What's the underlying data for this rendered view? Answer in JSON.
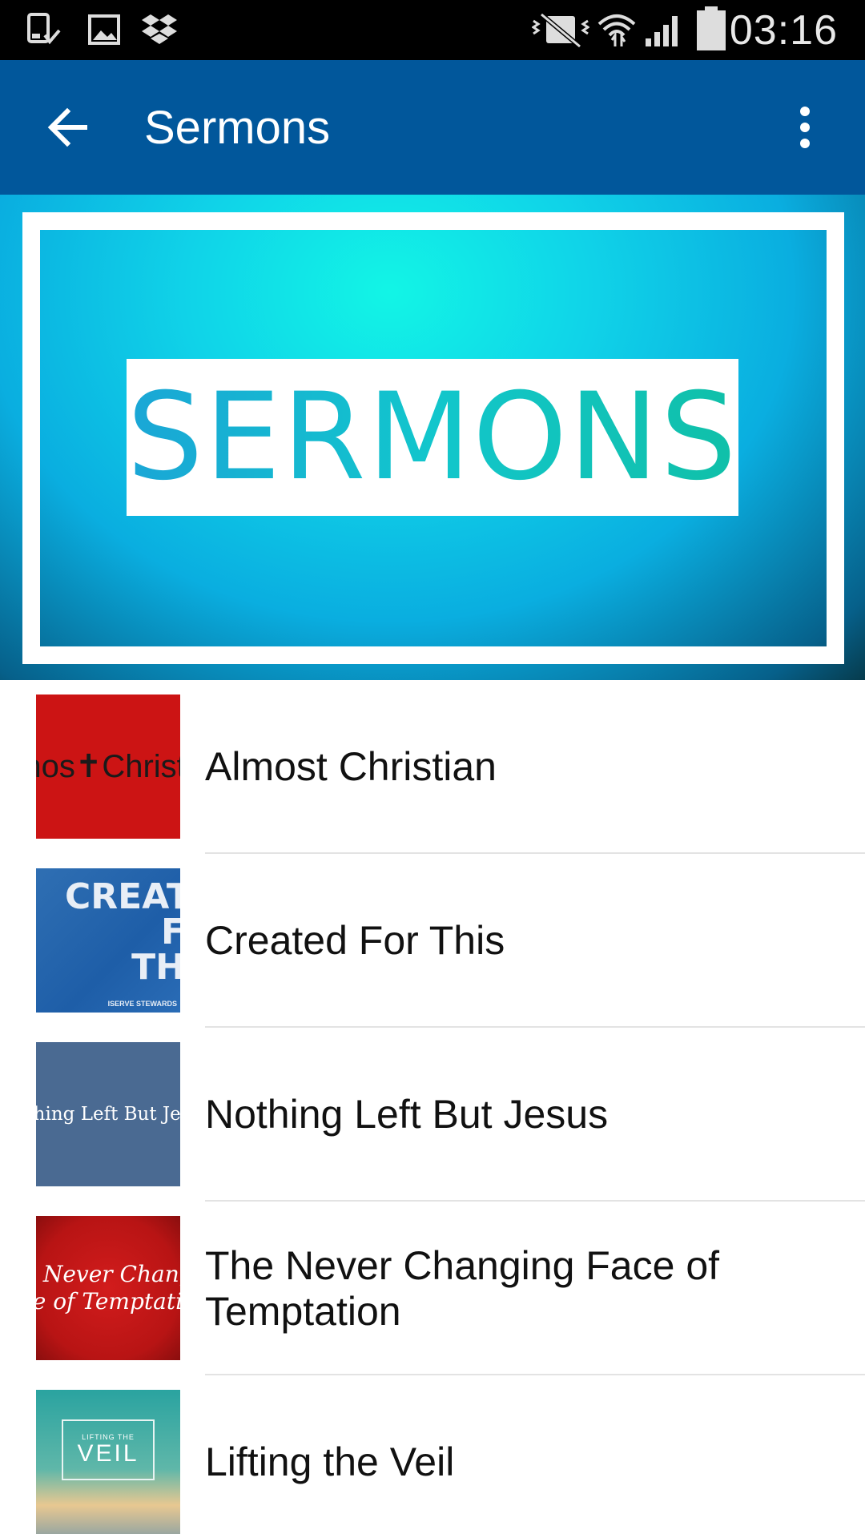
{
  "status_bar": {
    "time": "03:16",
    "icons": [
      "download-complete-icon",
      "image-icon",
      "dropbox-icon",
      "vibrate-icon",
      "wifi-icon",
      "signal-icon",
      "battery-icon"
    ]
  },
  "app_bar": {
    "title": "Sermons",
    "back_icon": "arrow-left-icon",
    "menu_icon": "overflow-menu-icon",
    "color": "#01579b"
  },
  "banner": {
    "text": "SERMONS"
  },
  "sermons": [
    {
      "title": "Almost Christian",
      "thumb_text": "nos✝Christi"
    },
    {
      "title": "Created For This",
      "thumb_text": "CREAT F TH",
      "thumb_subtext": "ISERVE STEWARDS"
    },
    {
      "title": "Nothing Left But Jesus",
      "thumb_text": "thing Left But Jes"
    },
    {
      "title": "The Never Changing Face of Temptation",
      "thumb_text_1": "e Never Chang",
      "thumb_text_2": "ce of Temptatio"
    },
    {
      "title": "Lifting the Veil",
      "thumb_text_1": "LIFTING THE",
      "thumb_text_2": "VEIL"
    }
  ]
}
